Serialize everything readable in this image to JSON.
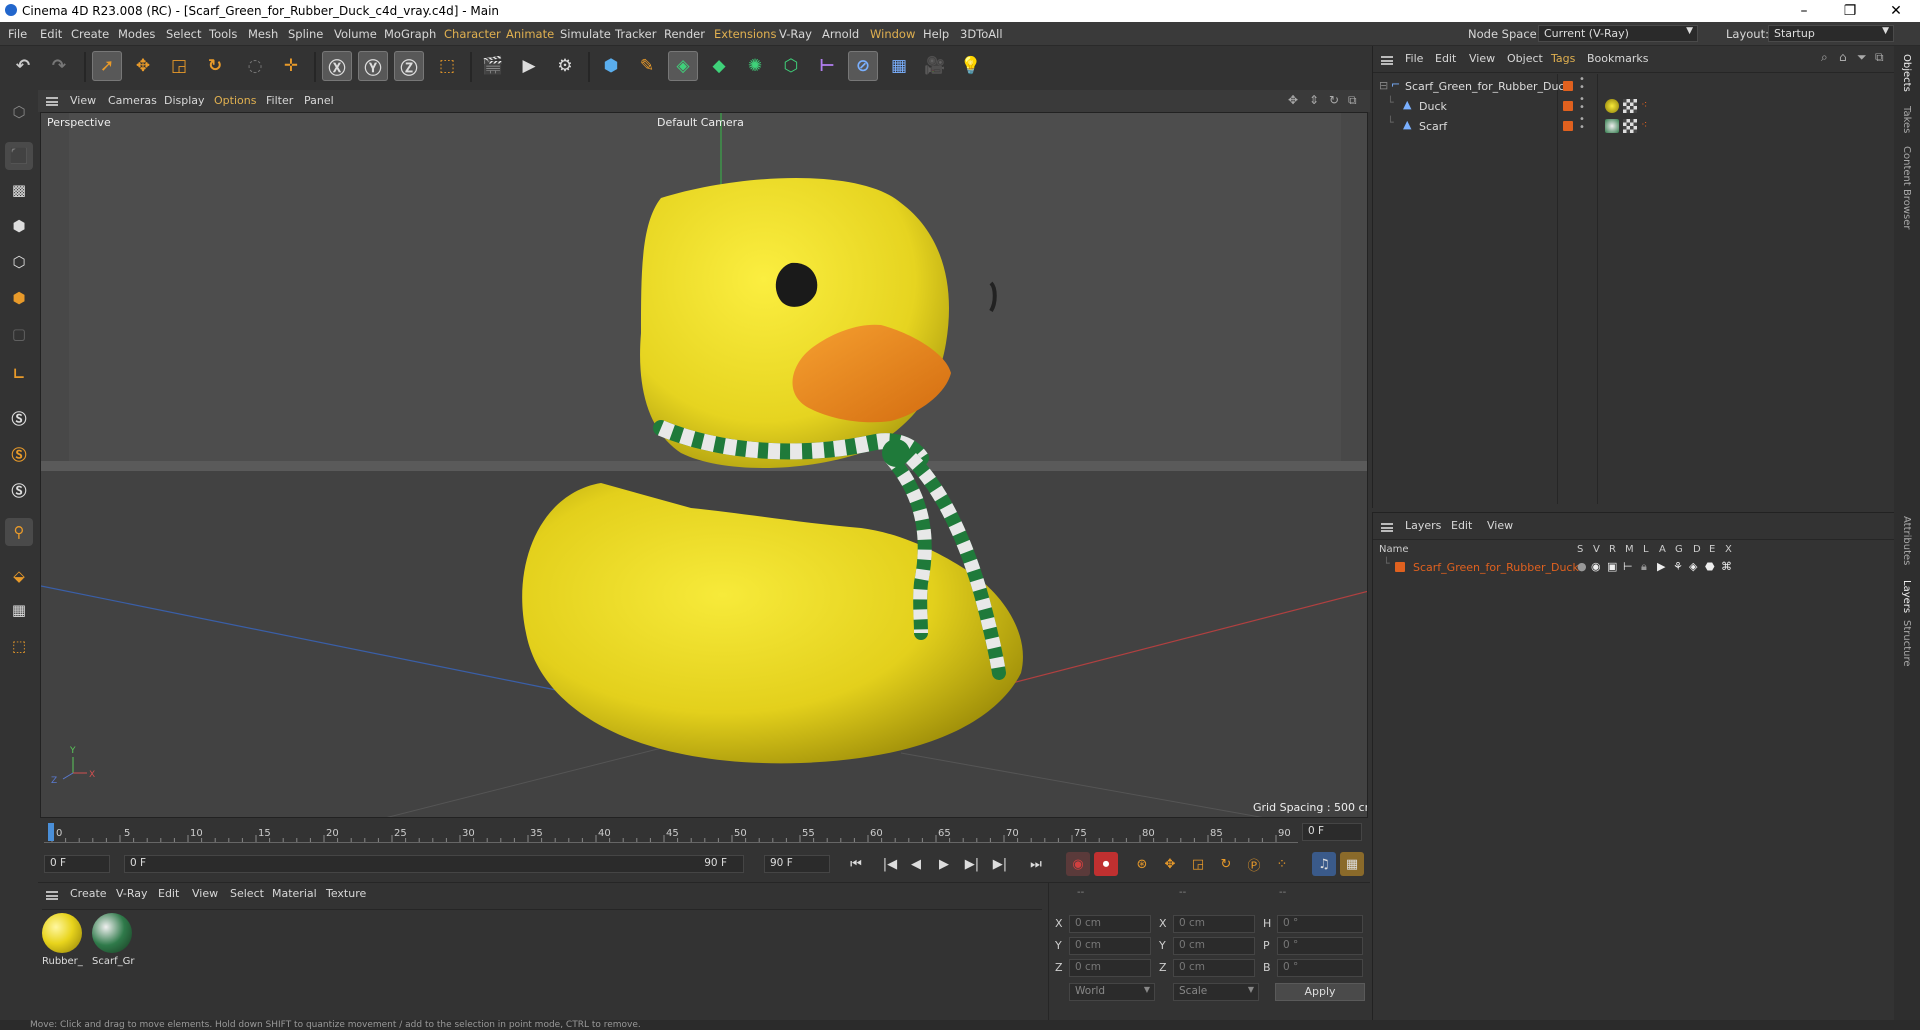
{
  "window": {
    "title": "Cinema 4D R23.008 (RC) - [Scarf_Green_for_Rubber_Duck_c4d_vray.c4d] - Main"
  },
  "menubar": {
    "items": [
      "File",
      "Edit",
      "Create",
      "Modes",
      "Select",
      "Tools",
      "Mesh",
      "Spline",
      "Volume",
      "MoGraph",
      "Character",
      "Animate",
      "Simulate",
      "Tracker",
      "Render",
      "Extensions",
      "V-Ray",
      "Arnold",
      "Window",
      "Help",
      "3DToAll"
    ],
    "node_space_label": "Node Space:",
    "node_space_value": "Current (V-Ray)",
    "layout_label": "Layout:",
    "layout_value": "Startup"
  },
  "viewport": {
    "menu": [
      "View",
      "Cameras",
      "Display",
      "Options",
      "Filter",
      "Panel"
    ],
    "label": "Perspective",
    "camera": "Default Camera",
    "grid_spacing": "Grid Spacing : 500 cm"
  },
  "timeline": {
    "ticks": [
      "0",
      "5",
      "10",
      "15",
      "20",
      "25",
      "30",
      "35",
      "40",
      "45",
      "50",
      "55",
      "60",
      "65",
      "70",
      "75",
      "80",
      "85",
      "90"
    ],
    "current_frame": "0 F",
    "start_frame": "0 F",
    "range_start": "0 F",
    "range_end": "90 F",
    "end_frame": "90 F"
  },
  "material_panel": {
    "menu": [
      "Create",
      "V-Ray",
      "Edit",
      "View",
      "Select",
      "Material",
      "Texture"
    ],
    "materials": [
      {
        "name": "Rubber_"
      },
      {
        "name": "Scarf_Gr"
      }
    ]
  },
  "attributes": {
    "header": [
      "--",
      "--",
      "--"
    ],
    "rows": [
      {
        "a": "X",
        "av": "0 cm",
        "b": "X",
        "bv": "0 cm",
        "c": "H",
        "cv": "0 °"
      },
      {
        "a": "Y",
        "av": "0 cm",
        "b": "Y",
        "bv": "0 cm",
        "c": "P",
        "cv": "0 °"
      },
      {
        "a": "Z",
        "av": "0 cm",
        "b": "Z",
        "bv": "0 cm",
        "c": "B",
        "cv": "0 °"
      }
    ],
    "coord_system": "World",
    "mode": "Scale",
    "apply_label": "Apply"
  },
  "object_manager": {
    "menu": [
      "File",
      "Edit",
      "View",
      "Object",
      "Tags",
      "Bookmarks"
    ],
    "objects": [
      {
        "name": "Scarf_Green_for_Rubber_Duck",
        "level": 0
      },
      {
        "name": "Duck",
        "level": 1
      },
      {
        "name": "Scarf",
        "level": 1
      }
    ]
  },
  "layer_manager": {
    "menu": [
      "Layers",
      "Edit",
      "View"
    ],
    "columns": [
      "Name",
      "S",
      "V",
      "R",
      "M",
      "L",
      "A",
      "G",
      "D",
      "E",
      "X"
    ],
    "layers": [
      {
        "name": "Scarf_Green_for_Rubber_Duck",
        "color": "#e0611f"
      }
    ]
  },
  "side_tabs": [
    "Objects",
    "Takes",
    "Content Browser",
    "Attributes",
    "Layers",
    "Structure"
  ],
  "status": "Move: Click and drag to move elements. Hold down SHIFT to quantize movement / add to the selection in point mode, CTRL to remove.",
  "colors": {
    "accent": "#e0611f",
    "highlight_menu": "#e0b050",
    "duck_yellow": "#f2e22a",
    "beak_orange": "#ee8a1e"
  }
}
